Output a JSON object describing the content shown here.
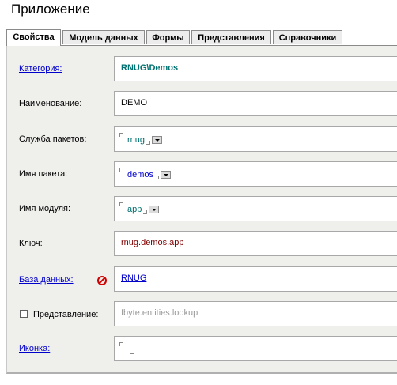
{
  "window": {
    "title": "Приложение"
  },
  "tabs": [
    {
      "label": "Свойства",
      "active": true
    },
    {
      "label": "Модель данных",
      "active": false
    },
    {
      "label": "Формы",
      "active": false
    },
    {
      "label": "Представления",
      "active": false
    },
    {
      "label": "Справочники",
      "active": false
    }
  ],
  "fields": {
    "category": {
      "label": "Категория:",
      "value": "RNUG\\Demos"
    },
    "name": {
      "label": "Наименование:",
      "value": "DEMO"
    },
    "package_service": {
      "label": "Служба пакетов:",
      "value": "rnug"
    },
    "package_name": {
      "label": "Имя пакета:",
      "value": "demos"
    },
    "module_name": {
      "label": "Имя модуля:",
      "value": "app"
    },
    "key": {
      "label": "Ключ:",
      "value": "rnug.demos.app"
    },
    "database": {
      "label": "База данных:",
      "value": "RNUG"
    },
    "view": {
      "label": "Представление:",
      "value": "fbyte.entities.lookup",
      "checked": false
    },
    "icon": {
      "label": "Иконка:",
      "value": ""
    }
  },
  "icons": {
    "database_status": "no-entry-icon"
  },
  "colors": {
    "teal": "#007070",
    "link": "#0000cc",
    "maroon": "#800000",
    "error": "#d00000"
  }
}
